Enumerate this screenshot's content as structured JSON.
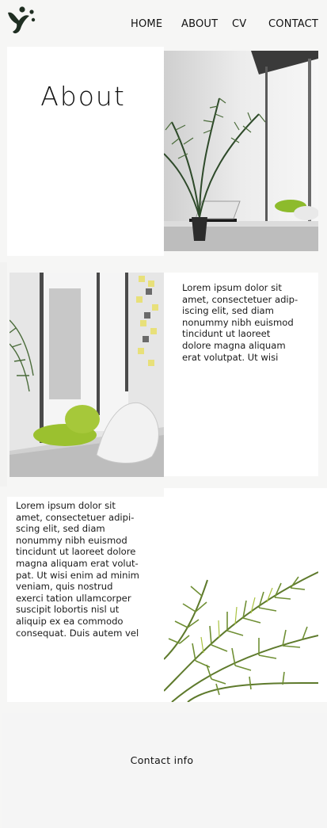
{
  "header": {
    "logo_icon": "leaf-figure-logo-icon",
    "nav": {
      "home": "HOME",
      "about": "ABOUT",
      "cv": "CV",
      "contact": "CONTACT"
    }
  },
  "about": {
    "title": "About",
    "paragraph_1": "Lorem ipsum dolor sit\namet, consectetuer adip-\niscing elit, sed diam\nnonummy nibh euismod\ntincidunt ut laoreet\ndolore magna aliquam\nerat volutpat. Ut wisi",
    "paragraph_2": "Lorem ipsum dolor sit\namet, consectetuer adipi-\nscing elit, sed diam\nnonummy nibh euismod\ntincidunt ut laoreet dolore\nmagna aliquam erat volut-\npat. Ut wisi enim ad minim\nveniam, quis nostrud\nexerci tation ullamcorper\nsuscipit lobortis nisl ut\naliquip ex ea commodo\nconsequat. Duis autem vel"
  },
  "images": {
    "photo_1": "palm-and-laptop-by-window-photo",
    "photo_2": "window-seat-with-cushions-photo",
    "photo_3": "palm-fronds-photo"
  },
  "footer": {
    "contact_info": "Contact info"
  },
  "colors": {
    "background": "#f6f6f5",
    "panel": "#ffffff",
    "logo": "#1f2e22",
    "accent_green": "#9bc12f"
  }
}
